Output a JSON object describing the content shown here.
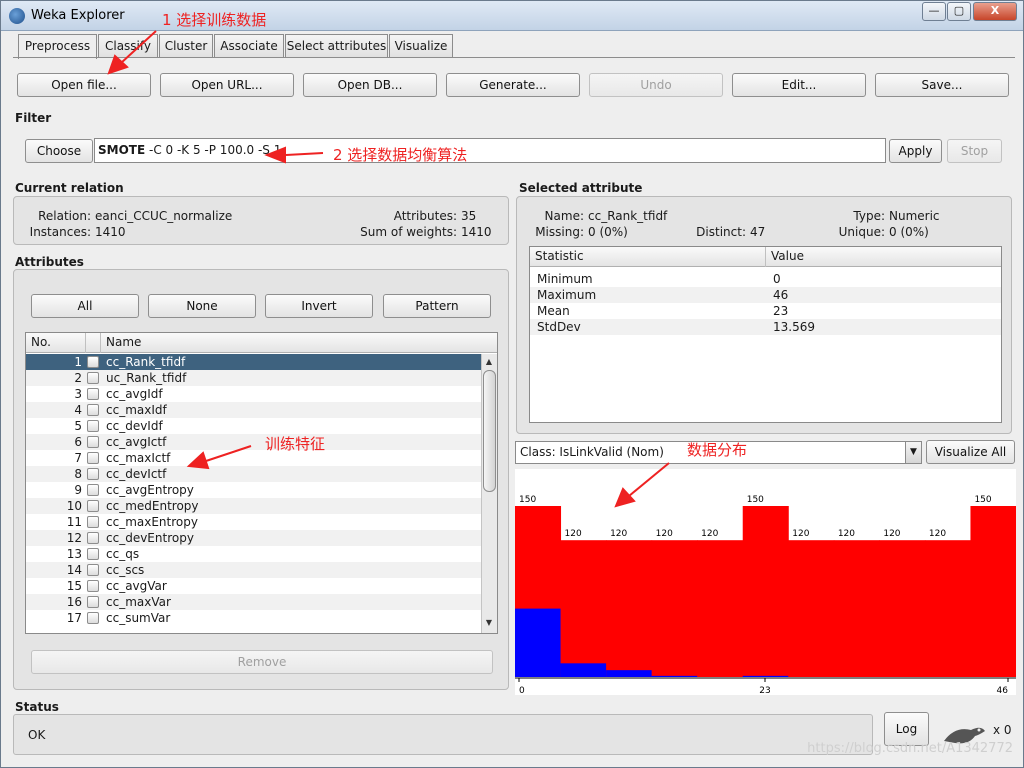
{
  "window": {
    "title": "Weka Explorer",
    "buttons": {
      "minimize": "—",
      "maximize": "▢",
      "close": "X"
    }
  },
  "tabs": [
    "Preprocess",
    "Classify",
    "Cluster",
    "Associate",
    "Select attributes",
    "Visualize"
  ],
  "toolbar": {
    "open_file": "Open file...",
    "open_url": "Open URL...",
    "open_db": "Open DB...",
    "generate": "Generate...",
    "undo": "Undo",
    "edit": "Edit...",
    "save": "Save..."
  },
  "filter": {
    "label": "Filter",
    "choose": "Choose",
    "name": "SMOTE",
    "options": " -C 0 -K 5 -P 100.0 -S 1",
    "apply": "Apply",
    "stop": "Stop"
  },
  "current_relation": {
    "label": "Current relation",
    "relation_label": "Relation:",
    "relation": "eanci_CCUC_normalize",
    "instances_label": "Instances:",
    "instances": "1410",
    "attributes_label": "Attributes:",
    "attributes": "35",
    "sum_weights_label": "Sum of weights:",
    "sum_weights": "1410"
  },
  "attributes": {
    "label": "Attributes",
    "buttons": {
      "all": "All",
      "none": "None",
      "invert": "Invert",
      "pattern": "Pattern"
    },
    "col_no": "No.",
    "col_name": "Name",
    "rows": [
      {
        "no": "1",
        "name": "cc_Rank_tfidf"
      },
      {
        "no": "2",
        "name": "uc_Rank_tfidf"
      },
      {
        "no": "3",
        "name": "cc_avgIdf"
      },
      {
        "no": "4",
        "name": "cc_maxIdf"
      },
      {
        "no": "5",
        "name": "cc_devIdf"
      },
      {
        "no": "6",
        "name": "cc_avgIctf"
      },
      {
        "no": "7",
        "name": "cc_maxIctf"
      },
      {
        "no": "8",
        "name": "cc_devIctf"
      },
      {
        "no": "9",
        "name": "cc_avgEntropy"
      },
      {
        "no": "10",
        "name": "cc_medEntropy"
      },
      {
        "no": "11",
        "name": "cc_maxEntropy"
      },
      {
        "no": "12",
        "name": "cc_devEntropy"
      },
      {
        "no": "13",
        "name": "cc_qs"
      },
      {
        "no": "14",
        "name": "cc_scs"
      },
      {
        "no": "15",
        "name": "cc_avgVar"
      },
      {
        "no": "16",
        "name": "cc_maxVar"
      },
      {
        "no": "17",
        "name": "cc_sumVar"
      }
    ],
    "remove": "Remove"
  },
  "selected_attribute": {
    "label": "Selected attribute",
    "name_label": "Name:",
    "name": "cc_Rank_tfidf",
    "type_label": "Type:",
    "type": "Numeric",
    "missing_label": "Missing:",
    "missing": "0 (0%)",
    "distinct_label": "Distinct:",
    "distinct": "47",
    "unique_label": "Unique:",
    "unique": "0 (0%)",
    "col_statistic": "Statistic",
    "col_value": "Value",
    "stats": [
      {
        "k": "Minimum",
        "v": "0"
      },
      {
        "k": "Maximum",
        "v": "46"
      },
      {
        "k": "Mean",
        "v": "23"
      },
      {
        "k": "StdDev",
        "v": "13.569"
      }
    ]
  },
  "class_select": {
    "value": "Class: IsLinkValid (Nom)",
    "visualize_all": "Visualize All"
  },
  "histogram": {
    "x_labels": [
      "0",
      "23",
      "46"
    ],
    "bin_labels": [
      "150",
      "120",
      "120",
      "120",
      "120",
      "150",
      "120",
      "120",
      "120",
      "120",
      "150"
    ],
    "colors": {
      "class_a": "#ff0000",
      "class_b": "#0000ff"
    },
    "bins": [
      {
        "total": 150,
        "blue": 60
      },
      {
        "total": 120,
        "blue": 12
      },
      {
        "total": 120,
        "blue": 6
      },
      {
        "total": 120,
        "blue": 1
      },
      {
        "total": 120,
        "blue": 0
      },
      {
        "total": 150,
        "blue": 1
      },
      {
        "total": 120,
        "blue": 0
      },
      {
        "total": 120,
        "blue": 0
      },
      {
        "total": 120,
        "blue": 0
      },
      {
        "total": 120,
        "blue": 0
      },
      {
        "total": 150,
        "blue": 0
      }
    ]
  },
  "annotations": {
    "a1": "1 选择训练数据",
    "a2": "2 选择数据均衡算法",
    "a3": "训练特征",
    "a4": "数据分布",
    "color": "#ee2222"
  },
  "status": {
    "label": "Status",
    "text": "OK",
    "log": "Log",
    "count": "x 0"
  },
  "watermark": "https://blog.csdn.net/A1342772"
}
